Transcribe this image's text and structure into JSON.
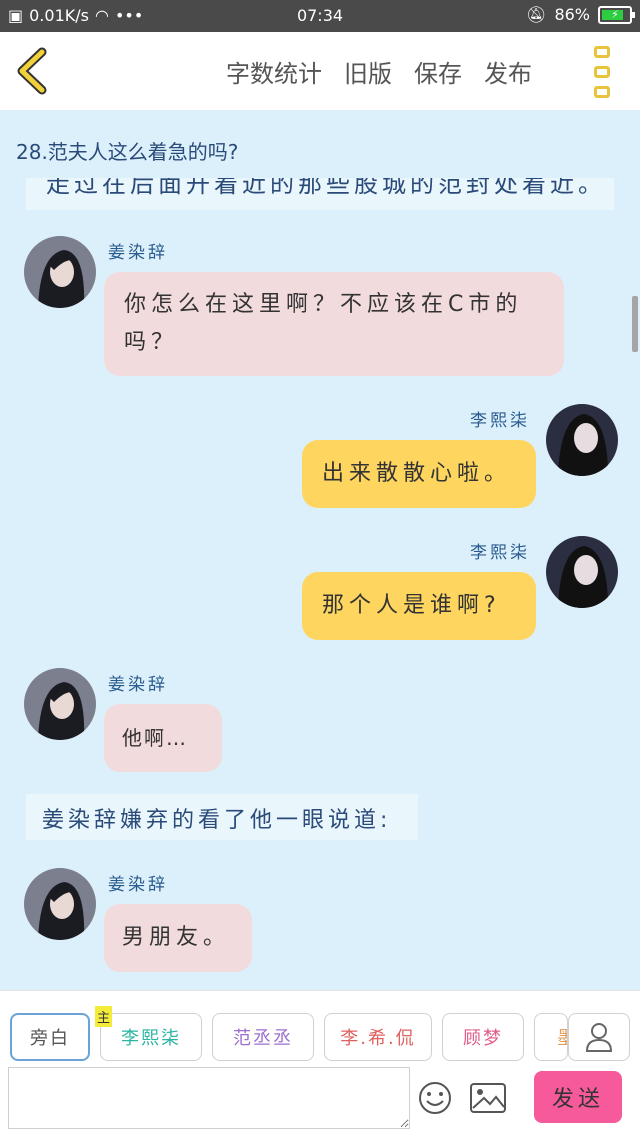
{
  "status_bar": {
    "network_speed": "0.01K/s",
    "time": "07:34",
    "battery_percent": "86%"
  },
  "toolbar": {
    "word_count": "字数统计",
    "old_version": "旧版",
    "save": "保存",
    "publish": "发布"
  },
  "chat": {
    "chapter_title": "28.范夫人这么着急的吗?",
    "cut_line_text": "走过在后面开着近的那些股城的范封处着近。",
    "messages": [
      {
        "speaker": "姜染辞",
        "text": "你怎么在这里啊？不应该在C市的吗？",
        "side": "left",
        "color": "pink"
      },
      {
        "speaker": "李熙柒",
        "text": "出来散散心啦。",
        "side": "right",
        "color": "yellow"
      },
      {
        "speaker": "李熙柒",
        "text": "那个人是谁啊?",
        "side": "right",
        "color": "yellow"
      },
      {
        "speaker": "姜染辞",
        "text": "他啊…",
        "side": "left",
        "color": "pink"
      },
      {
        "speaker": "姜染辞",
        "text": "男朋友。",
        "side": "left",
        "color": "pink"
      }
    ],
    "narration": "姜染辞嫌弃的看了他一眼说道:"
  },
  "bottom": {
    "roles": [
      "旁白",
      "李熙柒",
      "范丞丞",
      "李.希.侃",
      "顾梦",
      "墨"
    ],
    "main_badge": "主",
    "input_value": "",
    "send_label": "发送"
  },
  "colors": {
    "accent_yellow": "#fdd55f",
    "bubble_pink": "#f2dbdd",
    "send_pink": "#f75a9a",
    "chat_bg": "#dcf0fb"
  }
}
